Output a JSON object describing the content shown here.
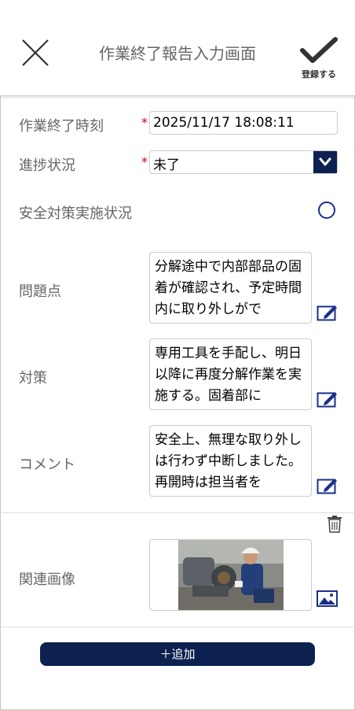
{
  "header": {
    "title": "作業終了報告入力画面",
    "save_label": "登録する"
  },
  "form": {
    "end_time": {
      "label": "作業終了時刻",
      "required_mark": "*",
      "value": "2025/11/17 18:08:11"
    },
    "progress": {
      "label": "進捗状況",
      "required_mark": "*",
      "value": "未了"
    },
    "safety": {
      "label": "安全対策実施状況"
    },
    "problem": {
      "label": "問題点",
      "value": "分解途中で内部部品の固着が確認され、予定時間内に取り外しがで"
    },
    "measure": {
      "label": "対策",
      "value": "専用工具を手配し、明日以降に再度分解作業を実施する。固着部に"
    },
    "comment": {
      "label": "コメント",
      "value": "安全上、無理な取り外しは行わず中断しました。再開時は担当者を"
    },
    "images": {
      "label": "関連画像"
    }
  },
  "add_button": {
    "label": "＋追加"
  },
  "colors": {
    "accent": "#0d2150",
    "required": "#d00000",
    "radio": "#1a2f8a"
  }
}
